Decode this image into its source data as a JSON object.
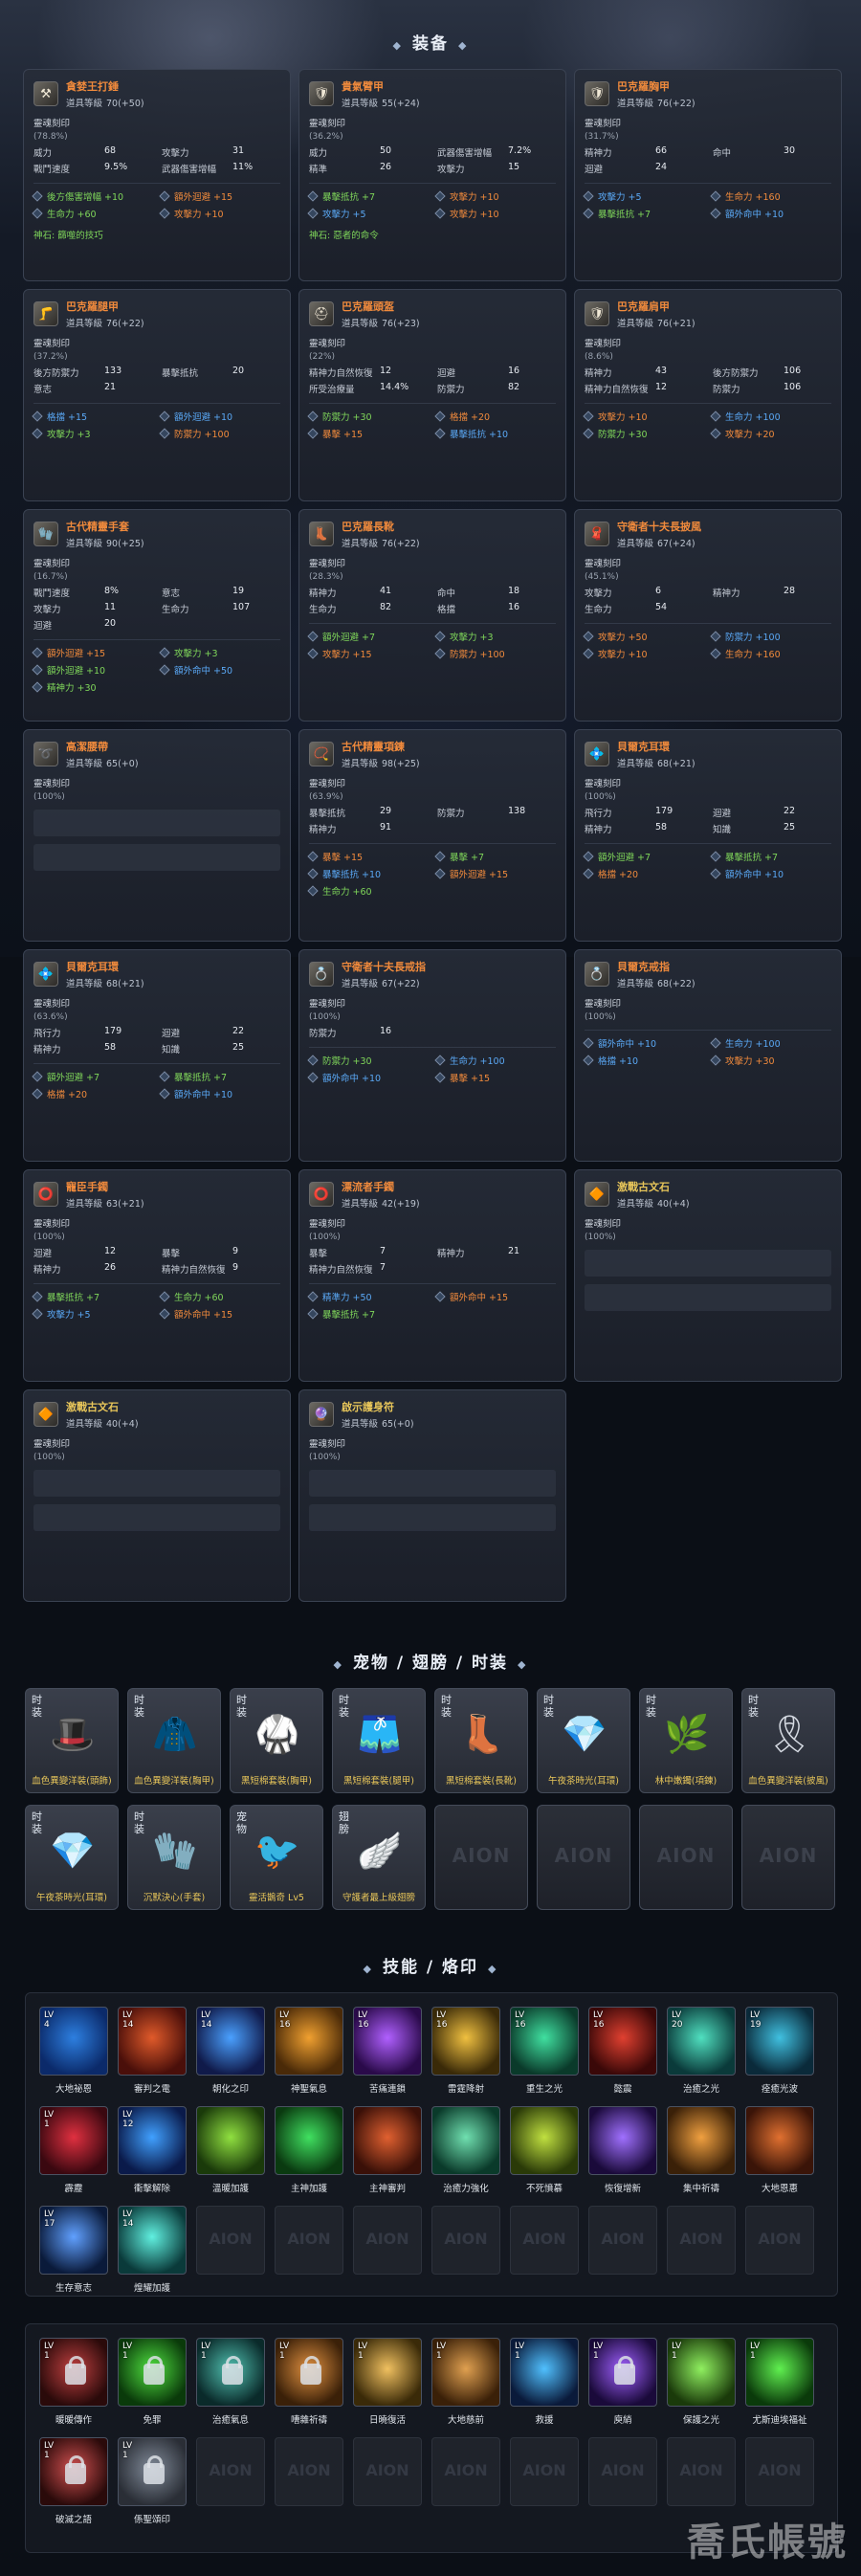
{
  "sections": {
    "equipment": "装备",
    "pets": "宠物 / 翅膀 / 时装",
    "skills": "技能 / 烙印"
  },
  "labels": {
    "item_level": "道具等級",
    "soul_seal": "靈魂刻印"
  },
  "equipment": [
    {
      "name": "貪婪王打錘",
      "name_color": "#f08a3c",
      "icon": "hammer-icon",
      "level": "70(+50)",
      "soul_pct": "(78.8%)",
      "stats": [
        [
          "威力",
          "68"
        ],
        [
          "攻擊力",
          "31"
        ],
        [
          "戰鬥速度",
          "9.5%"
        ],
        [
          "武器傷害增幅",
          "11%"
        ]
      ],
      "slots": [
        {
          "t": "後方傷害增幅 +10",
          "c": "green"
        },
        {
          "t": "額外迴避 +15",
          "c": "orange"
        },
        {
          "t": "生命力 +60",
          "c": "green"
        },
        {
          "t": "攻擊力 +10",
          "c": "orange"
        }
      ],
      "divine": "神石: 篩噬的技巧"
    },
    {
      "name": "貴氣臂甲",
      "name_color": "#f08a3c",
      "icon": "armor-icon",
      "level": "55(+24)",
      "soul_pct": "(36.2%)",
      "stats": [
        [
          "威力",
          "50"
        ],
        [
          "武器傷害增幅",
          "7.2%"
        ],
        [
          "精準",
          "26"
        ],
        [
          "攻擊力",
          "15"
        ]
      ],
      "slots": [
        {
          "t": "暴擊抵抗 +7",
          "c": "green"
        },
        {
          "t": "攻擊力 +10",
          "c": "orange"
        },
        {
          "t": "攻擊力 +5",
          "c": "blue"
        },
        {
          "t": "攻擊力 +10",
          "c": "orange"
        }
      ],
      "divine": "神石: 惡者的命令"
    },
    {
      "name": "巴克羅胸甲",
      "name_color": "#f08a3c",
      "icon": "chest-armor-icon",
      "level": "76(+22)",
      "soul_pct": "(31.7%)",
      "stats": [
        [
          "精神力",
          "66"
        ],
        [
          "命中",
          "30"
        ],
        [
          "迴避",
          "24"
        ]
      ],
      "slots": [
        {
          "t": "攻擊力 +5",
          "c": "blue"
        },
        {
          "t": "生命力 +160",
          "c": "orange"
        },
        {
          "t": "暴擊抵抗 +7",
          "c": "green"
        },
        {
          "t": "額外命中 +10",
          "c": "blue"
        }
      ],
      "divine": ""
    },
    {
      "name": "巴克羅腿甲",
      "name_color": "#f08a3c",
      "icon": "leg-armor-icon",
      "level": "76(+22)",
      "soul_pct": "(37.2%)",
      "stats": [
        [
          "後方防禦力",
          "133"
        ],
        [
          "暴擊抵抗",
          "20"
        ],
        [
          "意志",
          "21"
        ]
      ],
      "slots": [
        {
          "t": "格擋 +15",
          "c": "blue"
        },
        {
          "t": "額外迴避 +10",
          "c": "blue"
        },
        {
          "t": "攻擊力 +3",
          "c": "green"
        },
        {
          "t": "防禦力 +100",
          "c": "orange"
        }
      ],
      "divine": ""
    },
    {
      "name": "巴克羅頭盔",
      "name_color": "#f08a3c",
      "icon": "helmet-icon",
      "level": "76(+23)",
      "soul_pct": "(22%)",
      "stats": [
        [
          "精神力自然恢復",
          "12"
        ],
        [
          "迴避",
          "16"
        ],
        [
          "所受治療量",
          "14.4%"
        ],
        [
          "防禦力",
          "82"
        ]
      ],
      "slots": [
        {
          "t": "防禦力 +30",
          "c": "green"
        },
        {
          "t": "格擋 +20",
          "c": "orange"
        },
        {
          "t": "暴擊 +15",
          "c": "orange"
        },
        {
          "t": "暴擊抵抗 +10",
          "c": "blue"
        }
      ],
      "divine": ""
    },
    {
      "name": "巴克羅肩甲",
      "name_color": "#f08a3c",
      "icon": "shoulder-icon",
      "level": "76(+21)",
      "soul_pct": "(8.6%)",
      "stats": [
        [
          "精神力",
          "43"
        ],
        [
          "後方防禦力",
          "106"
        ],
        [
          "精神力自然恢復",
          "12"
        ],
        [
          "防禦力",
          "106"
        ]
      ],
      "slots": [
        {
          "t": "攻擊力 +10",
          "c": "orange"
        },
        {
          "t": "生命力 +100",
          "c": "blue"
        },
        {
          "t": "防禦力 +30",
          "c": "green"
        },
        {
          "t": "攻擊力 +20",
          "c": "orange"
        }
      ],
      "divine": ""
    },
    {
      "name": "古代精靈手套",
      "name_color": "#f08a3c",
      "icon": "glove-icon",
      "level": "90(+25)",
      "soul_pct": "(16.7%)",
      "stats": [
        [
          "戰鬥速度",
          "8%"
        ],
        [
          "意志",
          "19"
        ],
        [
          "攻擊力",
          "11"
        ],
        [
          "生命力",
          "107"
        ],
        [
          "迴避",
          "20"
        ]
      ],
      "slots": [
        {
          "t": "額外迴避 +15",
          "c": "orange"
        },
        {
          "t": "攻擊力 +3",
          "c": "green"
        },
        {
          "t": "額外迴避 +10",
          "c": "green"
        },
        {
          "t": "額外命中 +50",
          "c": "blue"
        },
        {
          "t": "精神力 +30",
          "c": "green"
        }
      ],
      "divine": ""
    },
    {
      "name": "巴克羅長靴",
      "name_color": "#f08a3c",
      "icon": "boots-icon",
      "level": "76(+22)",
      "soul_pct": "(28.3%)",
      "stats": [
        [
          "精神力",
          "41"
        ],
        [
          "命中",
          "18"
        ],
        [
          "生命力",
          "82"
        ],
        [
          "格擋",
          "16"
        ]
      ],
      "slots": [
        {
          "t": "額外迴避 +7",
          "c": "green"
        },
        {
          "t": "攻擊力 +3",
          "c": "green"
        },
        {
          "t": "攻擊力 +15",
          "c": "orange"
        },
        {
          "t": "防禦力 +100",
          "c": "orange"
        }
      ],
      "divine": ""
    },
    {
      "name": "守衛者十夫長披風",
      "name_color": "#f08a3c",
      "icon": "cape-icon",
      "level": "67(+24)",
      "soul_pct": "(45.1%)",
      "stats": [
        [
          "攻擊力",
          "6"
        ],
        [
          "精神力",
          "28"
        ],
        [
          "生命力",
          "54"
        ]
      ],
      "slots": [
        {
          "t": "攻擊力 +50",
          "c": "orange"
        },
        {
          "t": "防禦力 +100",
          "c": "blue"
        },
        {
          "t": "攻擊力 +10",
          "c": "orange"
        },
        {
          "t": "生命力 +160",
          "c": "orange"
        }
      ],
      "divine": ""
    },
    {
      "name": "高潔腰帶",
      "name_color": "#f08a3c",
      "icon": "belt-icon",
      "level": "65(+0)",
      "soul_pct": "(100%)",
      "stats": [],
      "slots": [],
      "divine": ""
    },
    {
      "name": "古代精靈項鍊",
      "name_color": "#f08a3c",
      "icon": "necklace-icon",
      "level": "98(+25)",
      "soul_pct": "(63.9%)",
      "stats": [
        [
          "暴擊抵抗",
          "29"
        ],
        [
          "防禦力",
          "138"
        ],
        [
          "精神力",
          "91"
        ]
      ],
      "slots": [
        {
          "t": "暴擊 +15",
          "c": "orange"
        },
        {
          "t": "暴擊 +7",
          "c": "green"
        },
        {
          "t": "暴擊抵抗 +10",
          "c": "blue"
        },
        {
          "t": "額外迴避 +15",
          "c": "orange"
        },
        {
          "t": "生命力 +60",
          "c": "green"
        }
      ],
      "divine": ""
    },
    {
      "name": "貝爾克耳環",
      "name_color": "#f08a3c",
      "icon": "earring-icon",
      "level": "68(+21)",
      "soul_pct": "(100%)",
      "stats": [
        [
          "飛行力",
          "179"
        ],
        [
          "迴避",
          "22"
        ],
        [
          "精神力",
          "58"
        ],
        [
          "知識",
          "25"
        ]
      ],
      "slots": [
        {
          "t": "額外迴避 +7",
          "c": "green"
        },
        {
          "t": "暴擊抵抗 +7",
          "c": "green"
        },
        {
          "t": "格擋 +20",
          "c": "orange"
        },
        {
          "t": "額外命中 +10",
          "c": "blue"
        }
      ],
      "divine": ""
    },
    {
      "name": "貝爾克耳環",
      "name_color": "#f08a3c",
      "icon": "earring-icon",
      "level": "68(+21)",
      "soul_pct": "(63.6%)",
      "stats": [
        [
          "飛行力",
          "179"
        ],
        [
          "迴避",
          "22"
        ],
        [
          "精神力",
          "58"
        ],
        [
          "知識",
          "25"
        ]
      ],
      "slots": [
        {
          "t": "額外迴避 +7",
          "c": "green"
        },
        {
          "t": "暴擊抵抗 +7",
          "c": "green"
        },
        {
          "t": "格擋 +20",
          "c": "orange"
        },
        {
          "t": "額外命中 +10",
          "c": "blue"
        }
      ],
      "divine": ""
    },
    {
      "name": "守衛者十夫長戒指",
      "name_color": "#f08a3c",
      "icon": "ring-icon",
      "level": "67(+22)",
      "soul_pct": "(100%)",
      "stats": [
        [
          "防禦力",
          "16"
        ]
      ],
      "slots": [
        {
          "t": "防禦力 +30",
          "c": "green"
        },
        {
          "t": "生命力 +100",
          "c": "blue"
        },
        {
          "t": "額外命中 +10",
          "c": "blue"
        },
        {
          "t": "暴擊 +15",
          "c": "orange"
        }
      ],
      "divine": ""
    },
    {
      "name": "貝爾克戒指",
      "name_color": "#f08a3c",
      "icon": "ring-icon",
      "level": "68(+22)",
      "soul_pct": "(100%)",
      "stats": [],
      "slots": [
        {
          "t": "額外命中 +10",
          "c": "blue"
        },
        {
          "t": "生命力 +100",
          "c": "blue"
        },
        {
          "t": "格擋 +10",
          "c": "blue"
        },
        {
          "t": "攻擊力 +30",
          "c": "orange"
        }
      ],
      "divine": ""
    },
    {
      "name": "寵臣手鐲",
      "name_color": "#f08a3c",
      "icon": "bracelet-icon",
      "level": "63(+21)",
      "soul_pct": "(100%)",
      "stats": [
        [
          "迴避",
          "12"
        ],
        [
          "暴擊",
          "9"
        ],
        [
          "精神力",
          "26"
        ],
        [
          "精神力自然恢復",
          "9"
        ]
      ],
      "slots": [
        {
          "t": "暴擊抵抗 +7",
          "c": "green"
        },
        {
          "t": "生命力 +60",
          "c": "green"
        },
        {
          "t": "攻擊力 +5",
          "c": "blue"
        },
        {
          "t": "額外命中 +15",
          "c": "orange"
        }
      ],
      "divine": ""
    },
    {
      "name": "漂流者手鐲",
      "name_color": "#f08a3c",
      "icon": "bracelet-icon",
      "level": "42(+19)",
      "soul_pct": "(100%)",
      "stats": [
        [
          "暴擊",
          "7"
        ],
        [
          "精神力",
          "21"
        ],
        [
          "精神力自然恢復",
          "7"
        ]
      ],
      "slots": [
        {
          "t": "精準力 +50",
          "c": "blue"
        },
        {
          "t": "額外命中 +15",
          "c": "orange"
        },
        {
          "t": "暴擊抵抗 +7",
          "c": "green"
        }
      ],
      "divine": ""
    },
    {
      "name": "激戰古文石",
      "name_color": "#e8c65a",
      "icon": "stone-icon",
      "level": "40(+4)",
      "soul_pct": "(100%)",
      "stats": [],
      "slots": [],
      "divine": ""
    },
    {
      "name": "激戰古文石",
      "name_color": "#e8c65a",
      "icon": "stone-icon",
      "level": "40(+4)",
      "soul_pct": "(100%)",
      "stats": [],
      "slots": [],
      "divine": ""
    },
    {
      "name": "啟示護身符",
      "name_color": "#e8c65a",
      "icon": "amulet-icon",
      "level": "65(+0)",
      "soul_pct": "(100%)",
      "stats": [],
      "slots": [],
      "divine": ""
    }
  ],
  "pets": {
    "row1": [
      {
        "tag": "时装",
        "label": "血色異變洋裝(頭飾)",
        "icon": "hat-icon",
        "glyph": "🎩"
      },
      {
        "tag": "时装",
        "label": "血色異變洋裝(胸甲)",
        "icon": "hood-icon",
        "glyph": "🧥"
      },
      {
        "tag": "时装",
        "label": "黑短棉套裝(胸甲)",
        "icon": "jacket-icon",
        "glyph": "🥋"
      },
      {
        "tag": "时装",
        "label": "黑短棉套裝(腿甲)",
        "icon": "shorts-icon",
        "glyph": "🩳"
      },
      {
        "tag": "时装",
        "label": "黑短棉套裝(長靴)",
        "icon": "boots-icon",
        "glyph": "👢"
      },
      {
        "tag": "时装",
        "label": "午夜茶時光(耳環)",
        "icon": "earring-icon",
        "glyph": "💎"
      },
      {
        "tag": "时装",
        "label": "林中嫩鐲(項鍊)",
        "icon": "vine-icon",
        "glyph": "🌿"
      },
      {
        "tag": "时装",
        "label": "血色異變洋裝(披風)",
        "icon": "cape-icon",
        "glyph": "🎗"
      }
    ],
    "row2": [
      {
        "tag": "时装",
        "label": "午夜茶時光(耳環)",
        "icon": "earring-icon",
        "glyph": "💎"
      },
      {
        "tag": "时装",
        "label": "沉默決心(手套)",
        "icon": "glove-icon",
        "glyph": "🧤"
      },
      {
        "tag": "宠物",
        "label": "靈活鵲奇 Lv5",
        "icon": "pet-icon",
        "glyph": "🐦"
      },
      {
        "tag": "翅膀",
        "label": "守護者最上級翅膀",
        "icon": "wing-icon",
        "glyph": "🪽"
      }
    ],
    "empty_mark": "AION"
  },
  "skills": {
    "active": [
      {
        "lv": "LV\n4",
        "name": "大地祕恩",
        "icon": "earth-blessing-icon",
        "c1": "#2d7fe0",
        "c2": "#0b2a6a"
      },
      {
        "lv": "LV\n14",
        "name": "審判之電",
        "icon": "lightning-icon",
        "c1": "#e05a2a",
        "c2": "#4a0f0a"
      },
      {
        "lv": "LV\n14",
        "name": "朝化之印",
        "icon": "seal-icon",
        "c1": "#4aa0ff",
        "c2": "#101a4a"
      },
      {
        "lv": "LV\n16",
        "name": "神聖氣息",
        "icon": "holy-breath-icon",
        "c1": "#f0a030",
        "c2": "#4a2a08"
      },
      {
        "lv": "LV\n16",
        "name": "苦痛連鎖",
        "icon": "chain-icon",
        "c1": "#b060ff",
        "c2": "#2a0a4a"
      },
      {
        "lv": "LV\n16",
        "name": "雷霆降射",
        "icon": "thunder-icon",
        "c1": "#f0c040",
        "c2": "#3a2a08"
      },
      {
        "lv": "LV\n16",
        "name": "重生之光",
        "icon": "rebirth-icon",
        "c1": "#40e0a0",
        "c2": "#0a3a2a"
      },
      {
        "lv": "LV\n16",
        "name": "懿震",
        "icon": "quake-icon",
        "c1": "#e04030",
        "c2": "#3a0808"
      },
      {
        "lv": "LV\n20",
        "name": "治癒之光",
        "icon": "heal-light-icon",
        "c1": "#50e0c0",
        "c2": "#0a3a3a"
      },
      {
        "lv": "LV\n19",
        "name": "痊癒光波",
        "icon": "heal-wave-icon",
        "c1": "#40c0e0",
        "c2": "#0a2a3a"
      },
      {
        "lv": "LV\n1",
        "name": "霹靂",
        "icon": "thunderclap-icon",
        "c1": "#e03040",
        "c2": "#3a0810"
      },
      {
        "lv": "LV\n12",
        "name": "衝擊解除",
        "icon": "dispel-icon",
        "c1": "#40a0ff",
        "c2": "#0a1a4a"
      },
      {
        "lv": "",
        "name": "溫暖加護",
        "icon": "warm-guard-icon",
        "c1": "#90e040",
        "c2": "#1a3a0a"
      },
      {
        "lv": "",
        "name": "主神加護",
        "icon": "god-guard-icon",
        "c1": "#40e060",
        "c2": "#0a3a10"
      },
      {
        "lv": "",
        "name": "主神審判",
        "icon": "god-judge-icon",
        "c1": "#e06030",
        "c2": "#3a1008"
      },
      {
        "lv": "",
        "name": "治癒力強化",
        "icon": "heal-boost-icon",
        "c1": "#70e0b0",
        "c2": "#0a3a2a"
      },
      {
        "lv": "",
        "name": "不死憤慕",
        "icon": "undying-icon",
        "c1": "#c0e040",
        "c2": "#2a3a08"
      },
      {
        "lv": "",
        "name": "恢復增新",
        "icon": "restore-icon",
        "c1": "#a070ff",
        "c2": "#1a0a3a"
      },
      {
        "lv": "",
        "name": "集中祈禱",
        "icon": "pray-icon",
        "c1": "#f0a040",
        "c2": "#3a2008"
      },
      {
        "lv": "",
        "name": "大地恩惠",
        "icon": "earth-grace-icon",
        "c1": "#e07030",
        "c2": "#3a1408"
      },
      {
        "lv": "LV\n17",
        "name": "生存意志",
        "icon": "survival-icon",
        "c1": "#60a0ff",
        "c2": "#0a1a3a"
      },
      {
        "lv": "LV\n14",
        "name": "煌耀加護",
        "icon": "radiant-icon",
        "c1": "#60f0e0",
        "c2": "#0a3a3a"
      }
    ],
    "passive": [
      {
        "lv": "LV\n1",
        "name": "暖暖傳作",
        "icon": "warm-icon",
        "c1": "#c04040",
        "c2": "#2a0a0a",
        "locked": true
      },
      {
        "lv": "LV\n1",
        "name": "免罪",
        "icon": "absolve-icon",
        "c1": "#50e040",
        "c2": "#0a3a0a",
        "locked": true
      },
      {
        "lv": "LV\n1",
        "name": "治癒氣息",
        "icon": "heal-breath-icon",
        "c1": "#50c0b0",
        "c2": "#0a2a2a",
        "locked": true
      },
      {
        "lv": "LV\n1",
        "name": "嘈雜祈禱",
        "icon": "noisy-pray-icon",
        "c1": "#e09040",
        "c2": "#3a2008",
        "locked": true
      },
      {
        "lv": "LV\n1",
        "name": "日曉復活",
        "icon": "dawn-revive-icon",
        "c1": "#f0c060",
        "c2": "#3a2a08",
        "locked": false
      },
      {
        "lv": "LV\n1",
        "name": "大地慈前",
        "icon": "earth-mercy-icon",
        "c1": "#e0a050",
        "c2": "#3a2008",
        "locked": false
      },
      {
        "lv": "LV\n1",
        "name": "救援",
        "icon": "rescue-icon",
        "c1": "#50c0ff",
        "c2": "#0a1a3a",
        "locked": false
      },
      {
        "lv": "LV\n1",
        "name": "庾綃",
        "icon": "bond-icon",
        "c1": "#a060ff",
        "c2": "#1a0a3a",
        "locked": true
      },
      {
        "lv": "LV\n1",
        "name": "保護之光",
        "icon": "protect-light-icon",
        "c1": "#90f060",
        "c2": "#1a3a0a",
        "locked": false
      },
      {
        "lv": "LV\n1",
        "name": "尤斯迪埃福祉",
        "icon": "yustiel-icon",
        "c1": "#60f050",
        "c2": "#0a3a0a",
        "locked": false
      },
      {
        "lv": "LV\n1",
        "name": "破滅之語",
        "icon": "ruin-word-icon",
        "c1": "#d05050",
        "c2": "#2a0a0a",
        "locked": true
      },
      {
        "lv": "LV\n1",
        "name": "係聖頌印",
        "icon": "holy-seal-icon",
        "c1": "#808a98",
        "c2": "#2a2e36",
        "locked": true
      }
    ],
    "empty_mark": "AION"
  },
  "watermark": "喬氏帳號"
}
